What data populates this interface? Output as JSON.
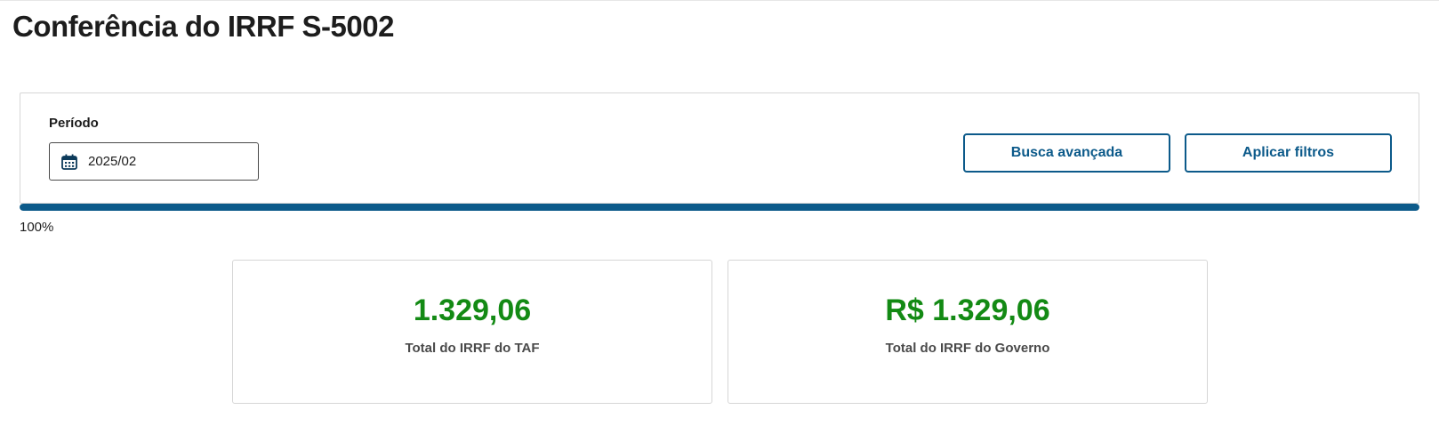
{
  "page": {
    "title": "Conferência do IRRF S-5002"
  },
  "filters": {
    "period_label": "Período",
    "period_value": "2025/02",
    "calendar_icon": "calendar-icon",
    "advanced_search_label": "Busca avançada",
    "apply_filters_label": "Aplicar filtros"
  },
  "progress": {
    "percent": 100,
    "text": "100%"
  },
  "totals": [
    {
      "value": "1.329,06",
      "label": "Total do IRRF do TAF"
    },
    {
      "value": "R$ 1.329,06",
      "label": "Total do IRRF do Governo"
    }
  ],
  "colors": {
    "primary": "#0c5a8a",
    "value_green": "#138a14",
    "border": "#d6d6d6"
  }
}
